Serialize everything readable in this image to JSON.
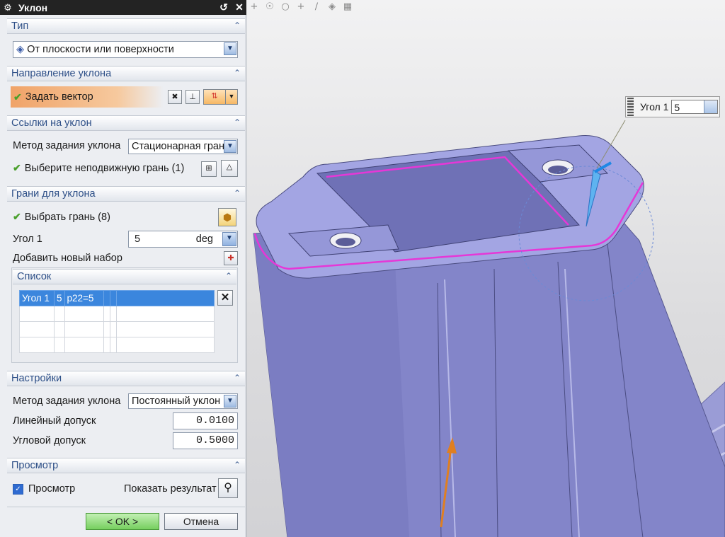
{
  "dialog": {
    "title": "Уклон",
    "type_section": {
      "header": "Тип",
      "value": "От плоскости или поверхности"
    },
    "direction_section": {
      "header": "Направление уклона",
      "vector_label": "Задать вектор"
    },
    "refs_section": {
      "header": "Ссылки на уклон",
      "method_label": "Метод задания уклона",
      "method_value": "Стационарная грань",
      "fixed_face_label": "Выберите неподвижную грань (1)"
    },
    "faces_section": {
      "header": "Грани для уклона",
      "select_label": "Выбрать грань (8)",
      "angle_label": "Угол 1",
      "angle_value": "5",
      "angle_unit": "deg",
      "add_set_label": "Добавить новый набор",
      "list_header": "Список",
      "list_rows": [
        {
          "name": "Угол 1",
          "value": "5",
          "expr": "p22=5"
        }
      ]
    },
    "settings_section": {
      "header": "Настройки",
      "method_label": "Метод задания уклона",
      "method_value": "Постоянный уклон",
      "linear_tol_label": "Линейный допуск",
      "linear_tol_value": "0.0100",
      "angular_tol_label": "Угловой допуск",
      "angular_tol_value": "0.5000"
    },
    "preview_section": {
      "header": "Просмотр",
      "preview_label": "Просмотр",
      "preview_checked": true,
      "show_result_label": "Показать результат"
    },
    "ok_label": "< OK >",
    "cancel_label": "Отмена"
  },
  "callout": {
    "label": "Угол 1",
    "value": "5"
  },
  "colors": {
    "accent_orange": "#f0a368",
    "model_fill": "#8c8ed2",
    "highlight_edge": "#e637d7",
    "ok_green": "#7fd46b",
    "list_selection": "#3b86dd"
  }
}
